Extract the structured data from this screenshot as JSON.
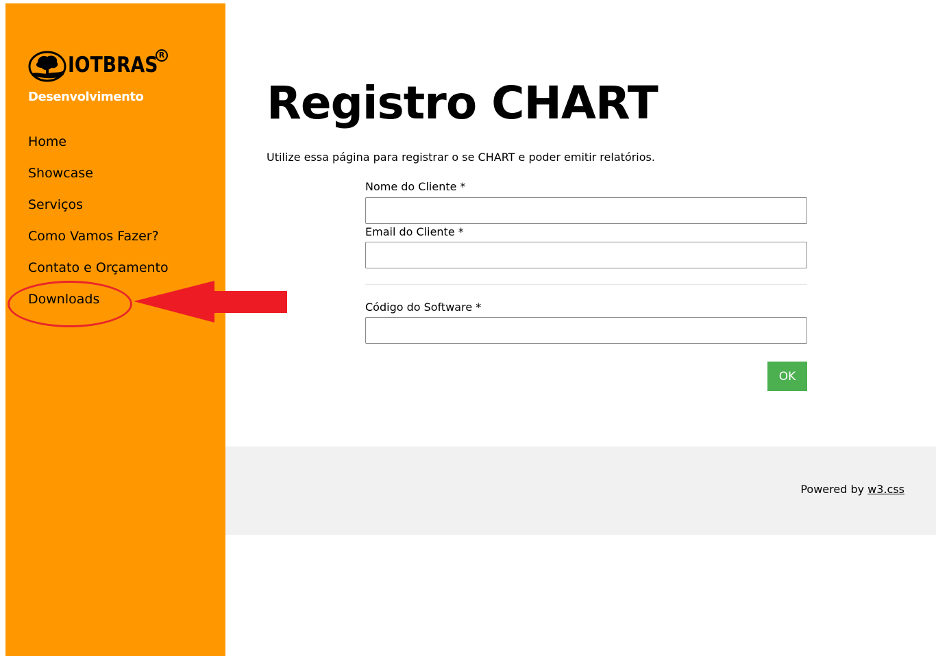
{
  "sidebar": {
    "brand": {
      "logo_text": "IOTBRAS",
      "registered_mark": "R",
      "subtitle": "Desenvolvimento"
    },
    "nav_items": [
      {
        "label": "Home"
      },
      {
        "label": "Showcase"
      },
      {
        "label": "Serviços"
      },
      {
        "label": "Como Vamos Fazer?"
      },
      {
        "label": "Contato e Orçamento"
      },
      {
        "label": "Downloads"
      }
    ]
  },
  "main": {
    "title": "Registro CHART",
    "intro": "Utilize essa página para registrar o se CHART e poder emitir relatórios.",
    "form": {
      "client_name_label": "Nome do Cliente *",
      "client_name_value": "",
      "client_email_label": "Email do Cliente *",
      "client_email_value": "",
      "software_code_label": "Código do Software *",
      "software_code_value": "",
      "submit_label": "OK"
    }
  },
  "footer": {
    "powered_by": "Powered by",
    "link_text": "w3.css"
  },
  "colors": {
    "sidebar_bg": "#ff9800",
    "button_green": "#4caf50",
    "footer_bg": "#f1f1f1",
    "annotation_red": "#e8262a"
  }
}
